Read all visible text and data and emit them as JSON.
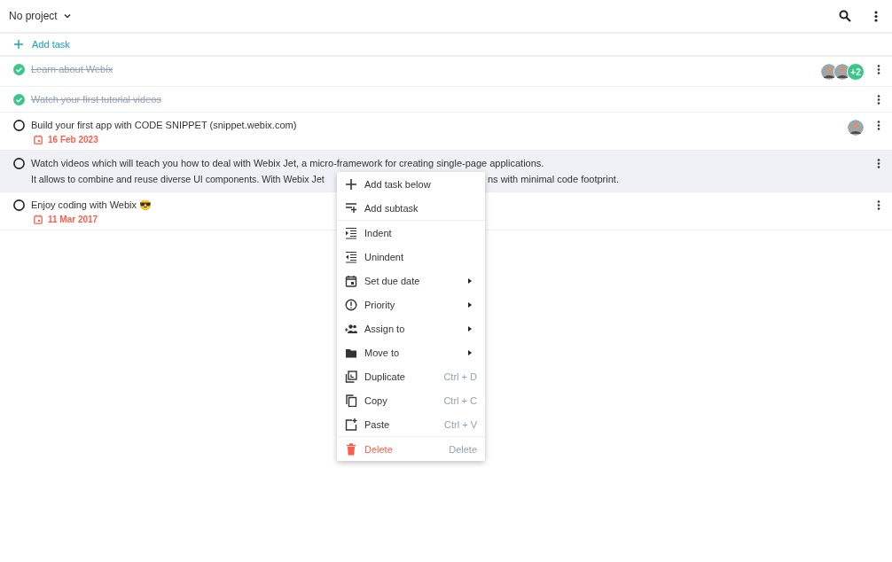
{
  "header": {
    "project": "No project"
  },
  "add_task": "Add task",
  "tasks": [
    {
      "text": "Learn about Webix",
      "done": true,
      "highlighted": false,
      "assignees": [
        {
          "kind": "avatar"
        },
        {
          "kind": "avatar"
        },
        {
          "kind": "more",
          "label": "+2"
        }
      ]
    },
    {
      "text": "Watch your first tutorial videos",
      "done": true,
      "highlighted": false
    },
    {
      "text": "Build your first app with CODE SNIPPET (snippet.webix.com)",
      "done": false,
      "highlighted": false,
      "due": "16 Feb 2023",
      "assignees": [
        {
          "kind": "avatar"
        }
      ]
    },
    {
      "text": "Watch videos which will teach you how to deal with Webix Jet, a micro-framework for creating single-page applications.",
      "text_2": "It allows to combine and reuse diverse UI components. With Webix Jet",
      "text_3": "ns with minimal code footprint.",
      "done": false,
      "highlighted": true
    },
    {
      "text": "Enjoy coding with Webix 😎",
      "done": false,
      "highlighted": false,
      "due": "11 Mar 2017"
    }
  ],
  "context_menu": {
    "groups": [
      [
        {
          "label": "Add task below"
        },
        {
          "label": "Add subtask"
        }
      ],
      [
        {
          "label": "Indent"
        },
        {
          "label": "Unindent"
        },
        {
          "label": "Set due date",
          "submenu": true
        },
        {
          "label": "Priority",
          "submenu": true
        },
        {
          "label": "Assign to",
          "submenu": true
        },
        {
          "label": "Move to",
          "submenu": true
        },
        {
          "label": "Duplicate",
          "shortcut": "Ctrl + D"
        },
        {
          "label": "Copy",
          "shortcut": "Ctrl + C"
        },
        {
          "label": "Paste",
          "shortcut": "Ctrl + V"
        }
      ],
      [
        {
          "label": "Delete",
          "shortcut": "Delete",
          "danger": true
        }
      ]
    ]
  }
}
